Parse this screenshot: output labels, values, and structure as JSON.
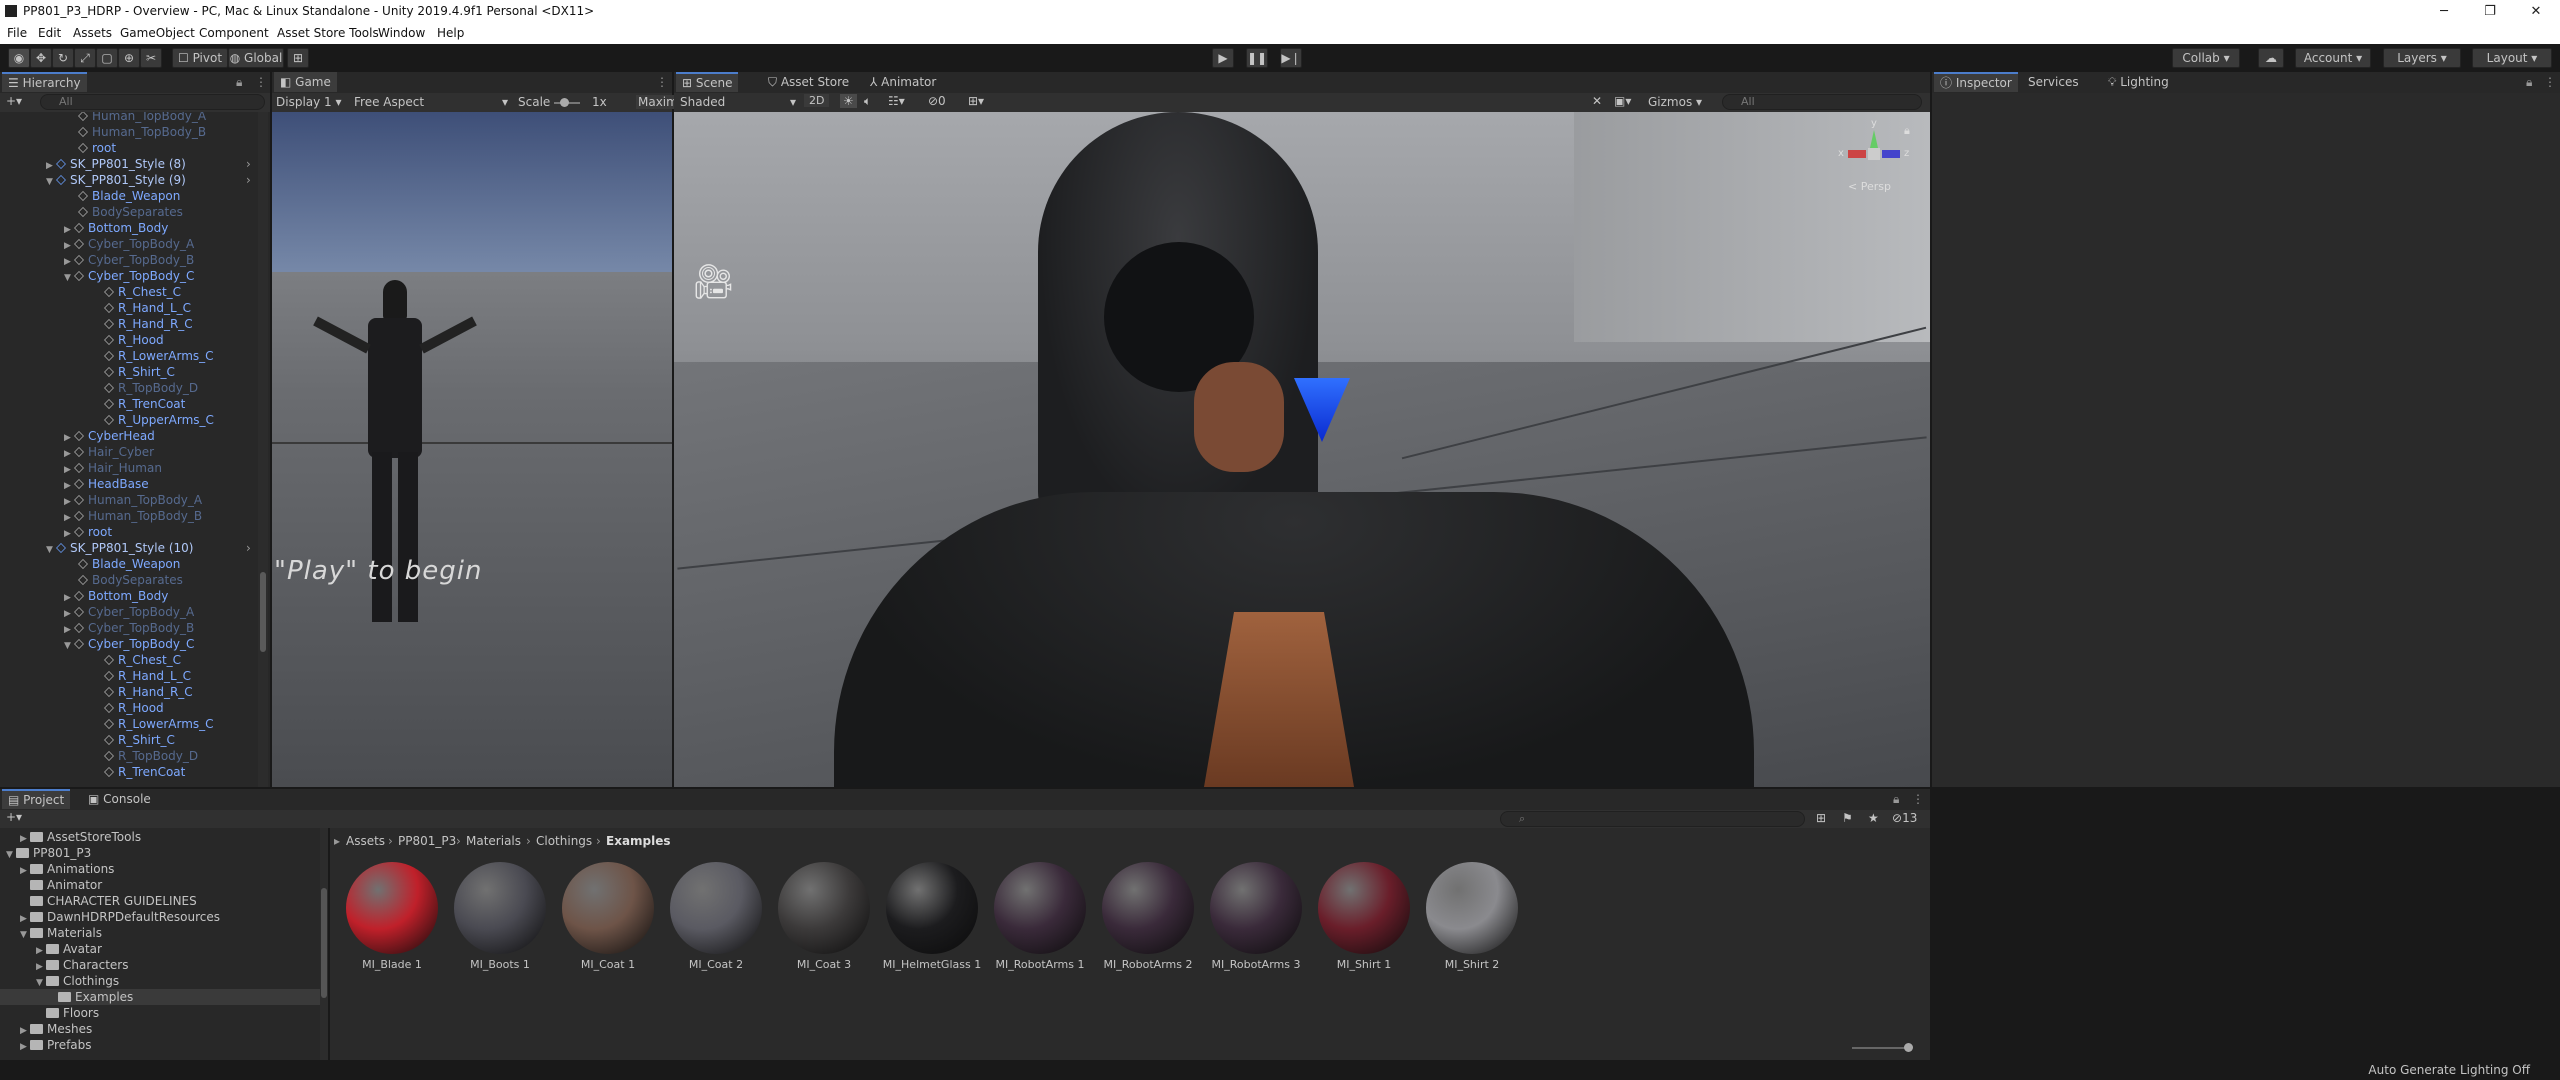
{
  "window": {
    "title": "PP801_P3_HDRP - Overview - PC, Mac & Linux Standalone - Unity 2019.4.9f1 Personal <DX11>",
    "controls": [
      "─",
      "❐",
      "✕"
    ]
  },
  "menu": [
    "File",
    "Edit",
    "Assets",
    "GameObject",
    "Component",
    "Asset Store Tools",
    "Window",
    "Help"
  ],
  "toolbar": {
    "pivot": "Pivot",
    "global": "Global",
    "collab": "Collab",
    "account": "Account",
    "layers": "Layers",
    "layout": "Layout"
  },
  "hierarchy": {
    "tab": "Hierarchy",
    "search_placeholder": "All",
    "rows": [
      {
        "label": "Human_TopBody_A",
        "indent": 2,
        "dim": true
      },
      {
        "label": "Human_TopBody_B",
        "indent": 2,
        "dim": true
      },
      {
        "label": "root",
        "indent": 2
      },
      {
        "label": "SK_PP801_Style (8)",
        "indent": 1,
        "prefab": true,
        "arrow": "▶"
      },
      {
        "label": "SK_PP801_Style (9)",
        "indent": 1,
        "prefab": true,
        "arrow": "▼"
      },
      {
        "label": "Blade_Weapon",
        "indent": 2
      },
      {
        "label": "BodySeparates",
        "indent": 2,
        "dim": true
      },
      {
        "label": "Bottom_Body",
        "indent": 2,
        "arrow": "▶"
      },
      {
        "label": "Cyber_TopBody_A",
        "indent": 2,
        "dim": true,
        "arrow": "▶"
      },
      {
        "label": "Cyber_TopBody_B",
        "indent": 2,
        "dim": true,
        "arrow": "▶"
      },
      {
        "label": "Cyber_TopBody_C",
        "indent": 2,
        "arrow": "▼"
      },
      {
        "label": "R_Chest_C",
        "indent": 3
      },
      {
        "label": "R_Hand_L_C",
        "indent": 3
      },
      {
        "label": "R_Hand_R_C",
        "indent": 3
      },
      {
        "label": "R_Hood",
        "indent": 3
      },
      {
        "label": "R_LowerArms_C",
        "indent": 3
      },
      {
        "label": "R_Shirt_C",
        "indent": 3
      },
      {
        "label": "R_TopBody_D",
        "indent": 3,
        "dim": true
      },
      {
        "label": "R_TrenCoat",
        "indent": 3
      },
      {
        "label": "R_UpperArms_C",
        "indent": 3
      },
      {
        "label": "CyberHead",
        "indent": 2,
        "arrow": "▶"
      },
      {
        "label": "Hair_Cyber",
        "indent": 2,
        "dim": true,
        "arrow": "▶"
      },
      {
        "label": "Hair_Human",
        "indent": 2,
        "dim": true,
        "arrow": "▶"
      },
      {
        "label": "HeadBase",
        "indent": 2,
        "arrow": "▶"
      },
      {
        "label": "Human_TopBody_A",
        "indent": 2,
        "dim": true,
        "arrow": "▶"
      },
      {
        "label": "Human_TopBody_B",
        "indent": 2,
        "dim": true,
        "arrow": "▶"
      },
      {
        "label": "root",
        "indent": 2,
        "arrow": "▶"
      },
      {
        "label": "SK_PP801_Style (10)",
        "indent": 1,
        "prefab": true,
        "arrow": "▼"
      },
      {
        "label": "Blade_Weapon",
        "indent": 2
      },
      {
        "label": "BodySeparates",
        "indent": 2,
        "dim": true
      },
      {
        "label": "Bottom_Body",
        "indent": 2,
        "arrow": "▶"
      },
      {
        "label": "Cyber_TopBody_A",
        "indent": 2,
        "dim": true,
        "arrow": "▶"
      },
      {
        "label": "Cyber_TopBody_B",
        "indent": 2,
        "dim": true,
        "arrow": "▶"
      },
      {
        "label": "Cyber_TopBody_C",
        "indent": 2,
        "arrow": "▼"
      },
      {
        "label": "R_Chest_C",
        "indent": 3
      },
      {
        "label": "R_Hand_L_C",
        "indent": 3
      },
      {
        "label": "R_Hand_R_C",
        "indent": 3
      },
      {
        "label": "R_Hood",
        "indent": 3
      },
      {
        "label": "R_LowerArms_C",
        "indent": 3
      },
      {
        "label": "R_Shirt_C",
        "indent": 3
      },
      {
        "label": "R_TopBody_D",
        "indent": 3,
        "dim": true
      },
      {
        "label": "R_TrenCoat",
        "indent": 3
      }
    ]
  },
  "game": {
    "tab": "Game",
    "display": "Display 1",
    "aspect": "Free Aspect",
    "scale_label": "Scale",
    "scale_value": "1x",
    "maximize": "Maxim",
    "play_text": "\"Play\" to begin"
  },
  "scene": {
    "tabs": [
      "Scene",
      "Asset Store",
      "Animator"
    ],
    "shading": "Shaded",
    "mode2d": "2D",
    "gizmos": "Gizmos",
    "search_placeholder": "All",
    "persp": "< Persp",
    "axis_y": "y",
    "axis_x": "x",
    "axis_z": "z"
  },
  "inspector": {
    "tabs": [
      "Inspector",
      "Services",
      "Lighting"
    ]
  },
  "project": {
    "tabs": [
      "Project",
      "Console"
    ],
    "count": "13",
    "tree": [
      {
        "label": "AssetStoreTools",
        "indent": 1,
        "arrow": "▶"
      },
      {
        "label": "PP801_P3",
        "indent": 0,
        "arrow": "▼"
      },
      {
        "label": "Animations",
        "indent": 1,
        "arrow": "▶"
      },
      {
        "label": "Animator",
        "indent": 1
      },
      {
        "label": "CHARACTER GUIDELINES",
        "indent": 1
      },
      {
        "label": "DawnHDRPDefaultResources",
        "indent": 1,
        "arrow": "▶"
      },
      {
        "label": "Materials",
        "indent": 1,
        "arrow": "▼"
      },
      {
        "label": "Avatar",
        "indent": 2,
        "arrow": "▶"
      },
      {
        "label": "Characters",
        "indent": 2,
        "arrow": "▶"
      },
      {
        "label": "Clothings",
        "indent": 2,
        "arrow": "▼"
      },
      {
        "label": "Examples",
        "indent": 3,
        "selected": true
      },
      {
        "label": "Floors",
        "indent": 2
      },
      {
        "label": "Meshes",
        "indent": 1,
        "arrow": "▶"
      },
      {
        "label": "Prefabs",
        "indent": 1,
        "arrow": "▶"
      }
    ],
    "breadcrumb": [
      "Assets",
      "PP801_P3",
      "Materials",
      "Clothings",
      "Examples"
    ],
    "materials": [
      {
        "name": "MI_Blade 1",
        "color": "#c0202a"
      },
      {
        "name": "MI_Boots 1",
        "color": "#4a4a52"
      },
      {
        "name": "MI_Coat 1",
        "color": "#6e5448"
      },
      {
        "name": "MI_Coat 2",
        "color": "#5a5a62"
      },
      {
        "name": "MI_Coat 3",
        "color": "#3c3a3a"
      },
      {
        "name": "MI_HelmetGlass 1",
        "color": "#1c1c1e"
      },
      {
        "name": "MI_RobotArms 1",
        "color": "#3a2a3a"
      },
      {
        "name": "MI_RobotArms 2",
        "color": "#3a2a3a"
      },
      {
        "name": "MI_RobotArms 3",
        "color": "#3a2a3a"
      },
      {
        "name": "MI_Shirt 1",
        "color": "#6a1e2a"
      },
      {
        "name": "MI_Shirt 2",
        "color": "#8a8a8e"
      }
    ]
  },
  "status": {
    "right": "Auto Generate Lighting Off"
  }
}
